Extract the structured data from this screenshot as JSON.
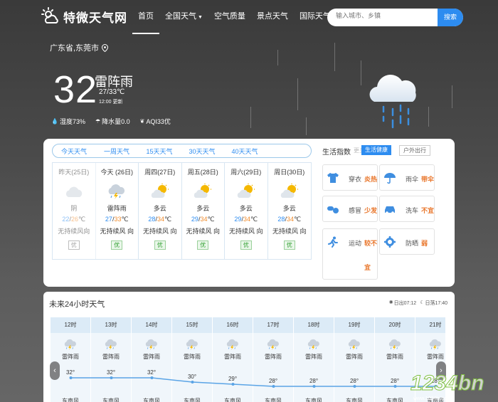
{
  "header": {
    "logo_text": "特微天气网",
    "nav": [
      {
        "label": "首页",
        "active": true
      },
      {
        "label": "全国天气",
        "caret": true
      },
      {
        "label": "空气质量"
      },
      {
        "label": "景点天气"
      },
      {
        "label": "国际天气"
      }
    ],
    "search_placeholder": "输入城市、乡镇",
    "search_button": "搜索"
  },
  "current": {
    "location": "广东省,东莞市",
    "temperature": "32",
    "condition": "雷阵雨",
    "range": "27/33℃",
    "update_time": "12:00 更新",
    "humidity": "湿度73%",
    "precip": "降水量0.0",
    "aqi": "AQI33优"
  },
  "forecast": {
    "tabs": [
      "今天天气",
      "一周天气",
      "15天天气",
      "30天天气",
      "40天天气"
    ],
    "days": [
      {
        "name": "昨天(25日)",
        "icon": "cloudy-icon",
        "cond": "阴",
        "lo": "22",
        "hi": "26",
        "wind": "无持续风向",
        "aq": "优",
        "past": true
      },
      {
        "name": "今天 (26日)",
        "icon": "thunder-rain-icon",
        "cond": "雷阵雨",
        "lo": "27",
        "hi": "33",
        "wind": "无持续风 向",
        "aq": "优"
      },
      {
        "name": "周四(27日)",
        "icon": "partly-cloudy-icon",
        "cond": "多云",
        "lo": "28",
        "hi": "34",
        "wind": "无持续风 向",
        "aq": "优"
      },
      {
        "name": "周五(28日)",
        "icon": "partly-cloudy-icon",
        "cond": "多云",
        "lo": "29",
        "hi": "34",
        "wind": "无持续风 向",
        "aq": "优"
      },
      {
        "name": "周六(29日)",
        "icon": "partly-cloudy-icon",
        "cond": "多云",
        "lo": "29",
        "hi": "34",
        "wind": "无持续风 向",
        "aq": "优"
      },
      {
        "name": "周日(30日)",
        "icon": "partly-cloudy-icon",
        "cond": "多云",
        "lo": "28",
        "hi": "34",
        "wind": "无持续风 向",
        "aq": "优"
      }
    ],
    "deg_unit": "℃"
  },
  "life": {
    "title": "生活指数",
    "more": "更多",
    "btn_health": "生活健康",
    "btn_outdoor": "户外出行",
    "items": [
      {
        "icon": "tshirt-icon",
        "name": "穿衣",
        "value": "炎热"
      },
      {
        "icon": "umbrella-icon",
        "name": "雨伞",
        "value": "带伞"
      },
      {
        "icon": "pill-icon",
        "name": "感冒",
        "value": "少发"
      },
      {
        "icon": "car-icon",
        "name": "洗车",
        "value": "不宜"
      },
      {
        "icon": "runner-icon",
        "name": "运动",
        "value": "较不宜"
      },
      {
        "icon": "gear-icon",
        "name": "防晒",
        "value": "弱"
      }
    ]
  },
  "hourly": {
    "title": "未来24小时天气",
    "sunrise": "日出07:12",
    "sunset": "日落17:40",
    "hours": [
      {
        "time": "12时",
        "cond": "雷阵雨",
        "deg": "32°",
        "temp": 32,
        "wind": "东南风"
      },
      {
        "time": "13时",
        "cond": "雷阵雨",
        "deg": "32°",
        "temp": 32,
        "wind": "东南风"
      },
      {
        "time": "14时",
        "cond": "雷阵雨",
        "deg": "32°",
        "temp": 32,
        "wind": "东南风"
      },
      {
        "time": "15时",
        "cond": "雷阵雨",
        "deg": "30°",
        "temp": 30,
        "wind": "东南风"
      },
      {
        "time": "16时",
        "cond": "雷阵雨",
        "deg": "29°",
        "temp": 29,
        "wind": "东南风"
      },
      {
        "time": "17时",
        "cond": "雷阵雨",
        "deg": "28°",
        "temp": 28,
        "wind": "东南风"
      },
      {
        "time": "18时",
        "cond": "雷阵雨",
        "deg": "28°",
        "temp": 28,
        "wind": "东南风"
      },
      {
        "time": "19时",
        "cond": "雷阵雨",
        "deg": "28°",
        "temp": 28,
        "wind": "东南风"
      },
      {
        "time": "20时",
        "cond": "雷阵雨",
        "deg": "28°",
        "temp": 28,
        "wind": "东南风"
      },
      {
        "time": "21时",
        "cond": "雷阵雨",
        "deg": "28°",
        "temp": 28,
        "wind": "东南风"
      }
    ]
  },
  "watermark": "1234bn",
  "watermark_sub": "www.1234la.com"
}
